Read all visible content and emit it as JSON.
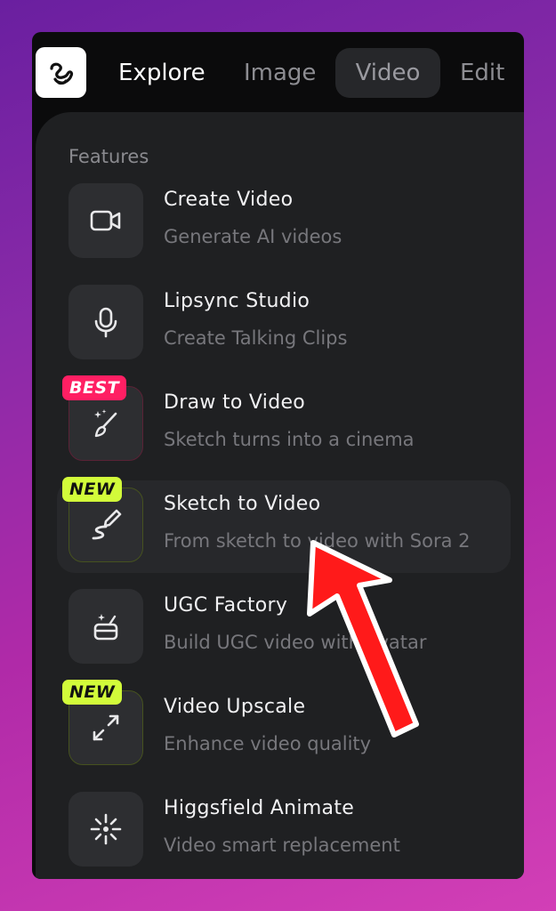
{
  "nav": {
    "logo_icon": "squiggle-logo-icon",
    "tabs": [
      {
        "label": "Explore"
      },
      {
        "label": "Image"
      },
      {
        "label": "Video"
      },
      {
        "label": "Edit"
      }
    ]
  },
  "features": {
    "section_title": "Features",
    "items": [
      {
        "title": "Create Video",
        "subtitle": "Generate AI videos",
        "icon": "video-camera-icon"
      },
      {
        "title": "Lipsync Studio",
        "subtitle": "Create Talking Clips",
        "icon": "microphone-icon"
      },
      {
        "title": "Draw to Video",
        "subtitle": "Sketch turns into a cinema",
        "icon": "magic-brush-icon",
        "badge": "BEST"
      },
      {
        "title": "Sketch to Video",
        "subtitle": "From sketch to video with Sora 2",
        "icon": "pen-squiggle-icon",
        "badge": "NEW"
      },
      {
        "title": "UGC Factory",
        "subtitle": "Build UGC video with avatar",
        "icon": "sparkle-pot-icon"
      },
      {
        "title": "Video Upscale",
        "subtitle": "Enhance video quality",
        "icon": "expand-arrows-icon",
        "badge": "NEW"
      },
      {
        "title": "Higgsfield Animate",
        "subtitle": "Video smart replacement",
        "icon": "burst-icon"
      }
    ]
  },
  "colors": {
    "badge_best": "#ff1f63",
    "badge_new": "#d2fb3a",
    "arrow": "#ff1a1a"
  }
}
